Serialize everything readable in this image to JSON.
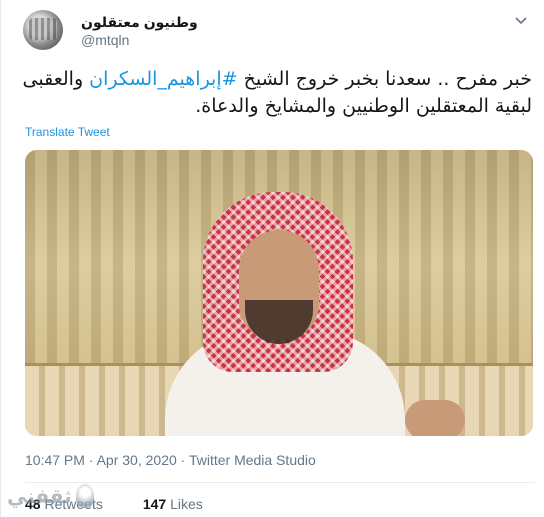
{
  "user": {
    "display_name": "وطنيون معتقلون",
    "handle": "@mtqln"
  },
  "tweet": {
    "text_part1": "خبر مفرح .. سعدنا بخبر خروج الشيخ ",
    "hashtag": "#إبراهيم_السكران",
    "text_part2": " والعقبى لبقية المعتقلين الوطنيين والمشايخ والدعاة.",
    "translate_label": "Translate Tweet"
  },
  "meta": {
    "timestamp": "10:47 PM · Apr 30, 2020 · Twitter Media Studio"
  },
  "stats": {
    "retweets_count": "48",
    "retweets_label": "Retweets",
    "likes_count": "147",
    "likes_label": "Likes"
  },
  "watermark": {
    "text": "ثقفني"
  },
  "icons": {
    "menu": "chevron-down-icon"
  },
  "colors": {
    "link": "#1b95e0",
    "secondary": "#657786",
    "primary_text": "#14171a"
  }
}
